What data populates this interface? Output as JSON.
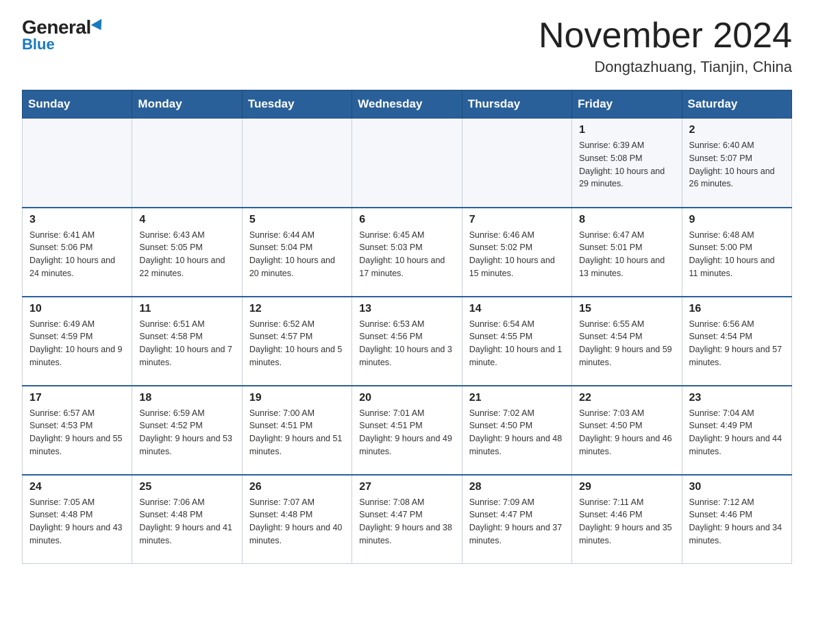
{
  "logo": {
    "general": "General",
    "blue": "Blue"
  },
  "title": {
    "month_year": "November 2024",
    "location": "Dongtazhuang, Tianjin, China"
  },
  "days_of_week": [
    "Sunday",
    "Monday",
    "Tuesday",
    "Wednesday",
    "Thursday",
    "Friday",
    "Saturday"
  ],
  "weeks": [
    [
      {
        "day": "",
        "info": ""
      },
      {
        "day": "",
        "info": ""
      },
      {
        "day": "",
        "info": ""
      },
      {
        "day": "",
        "info": ""
      },
      {
        "day": "",
        "info": ""
      },
      {
        "day": "1",
        "info": "Sunrise: 6:39 AM\nSunset: 5:08 PM\nDaylight: 10 hours\nand 29 minutes."
      },
      {
        "day": "2",
        "info": "Sunrise: 6:40 AM\nSunset: 5:07 PM\nDaylight: 10 hours\nand 26 minutes."
      }
    ],
    [
      {
        "day": "3",
        "info": "Sunrise: 6:41 AM\nSunset: 5:06 PM\nDaylight: 10 hours\nand 24 minutes."
      },
      {
        "day": "4",
        "info": "Sunrise: 6:43 AM\nSunset: 5:05 PM\nDaylight: 10 hours\nand 22 minutes."
      },
      {
        "day": "5",
        "info": "Sunrise: 6:44 AM\nSunset: 5:04 PM\nDaylight: 10 hours\nand 20 minutes."
      },
      {
        "day": "6",
        "info": "Sunrise: 6:45 AM\nSunset: 5:03 PM\nDaylight: 10 hours\nand 17 minutes."
      },
      {
        "day": "7",
        "info": "Sunrise: 6:46 AM\nSunset: 5:02 PM\nDaylight: 10 hours\nand 15 minutes."
      },
      {
        "day": "8",
        "info": "Sunrise: 6:47 AM\nSunset: 5:01 PM\nDaylight: 10 hours\nand 13 minutes."
      },
      {
        "day": "9",
        "info": "Sunrise: 6:48 AM\nSunset: 5:00 PM\nDaylight: 10 hours\nand 11 minutes."
      }
    ],
    [
      {
        "day": "10",
        "info": "Sunrise: 6:49 AM\nSunset: 4:59 PM\nDaylight: 10 hours\nand 9 minutes."
      },
      {
        "day": "11",
        "info": "Sunrise: 6:51 AM\nSunset: 4:58 PM\nDaylight: 10 hours\nand 7 minutes."
      },
      {
        "day": "12",
        "info": "Sunrise: 6:52 AM\nSunset: 4:57 PM\nDaylight: 10 hours\nand 5 minutes."
      },
      {
        "day": "13",
        "info": "Sunrise: 6:53 AM\nSunset: 4:56 PM\nDaylight: 10 hours\nand 3 minutes."
      },
      {
        "day": "14",
        "info": "Sunrise: 6:54 AM\nSunset: 4:55 PM\nDaylight: 10 hours\nand 1 minute."
      },
      {
        "day": "15",
        "info": "Sunrise: 6:55 AM\nSunset: 4:54 PM\nDaylight: 9 hours\nand 59 minutes."
      },
      {
        "day": "16",
        "info": "Sunrise: 6:56 AM\nSunset: 4:54 PM\nDaylight: 9 hours\nand 57 minutes."
      }
    ],
    [
      {
        "day": "17",
        "info": "Sunrise: 6:57 AM\nSunset: 4:53 PM\nDaylight: 9 hours\nand 55 minutes."
      },
      {
        "day": "18",
        "info": "Sunrise: 6:59 AM\nSunset: 4:52 PM\nDaylight: 9 hours\nand 53 minutes."
      },
      {
        "day": "19",
        "info": "Sunrise: 7:00 AM\nSunset: 4:51 PM\nDaylight: 9 hours\nand 51 minutes."
      },
      {
        "day": "20",
        "info": "Sunrise: 7:01 AM\nSunset: 4:51 PM\nDaylight: 9 hours\nand 49 minutes."
      },
      {
        "day": "21",
        "info": "Sunrise: 7:02 AM\nSunset: 4:50 PM\nDaylight: 9 hours\nand 48 minutes."
      },
      {
        "day": "22",
        "info": "Sunrise: 7:03 AM\nSunset: 4:50 PM\nDaylight: 9 hours\nand 46 minutes."
      },
      {
        "day": "23",
        "info": "Sunrise: 7:04 AM\nSunset: 4:49 PM\nDaylight: 9 hours\nand 44 minutes."
      }
    ],
    [
      {
        "day": "24",
        "info": "Sunrise: 7:05 AM\nSunset: 4:48 PM\nDaylight: 9 hours\nand 43 minutes."
      },
      {
        "day": "25",
        "info": "Sunrise: 7:06 AM\nSunset: 4:48 PM\nDaylight: 9 hours\nand 41 minutes."
      },
      {
        "day": "26",
        "info": "Sunrise: 7:07 AM\nSunset: 4:48 PM\nDaylight: 9 hours\nand 40 minutes."
      },
      {
        "day": "27",
        "info": "Sunrise: 7:08 AM\nSunset: 4:47 PM\nDaylight: 9 hours\nand 38 minutes."
      },
      {
        "day": "28",
        "info": "Sunrise: 7:09 AM\nSunset: 4:47 PM\nDaylight: 9 hours\nand 37 minutes."
      },
      {
        "day": "29",
        "info": "Sunrise: 7:11 AM\nSunset: 4:46 PM\nDaylight: 9 hours\nand 35 minutes."
      },
      {
        "day": "30",
        "info": "Sunrise: 7:12 AM\nSunset: 4:46 PM\nDaylight: 9 hours\nand 34 minutes."
      }
    ]
  ]
}
